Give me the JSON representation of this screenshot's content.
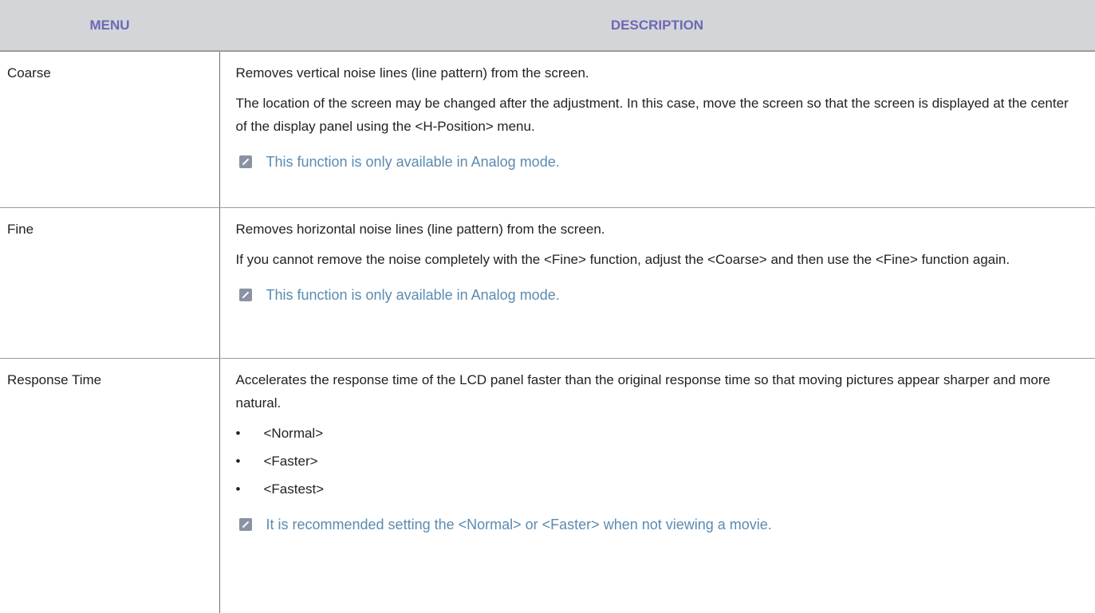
{
  "header": {
    "menu_label": "MENU",
    "description_label": "DESCRIPTION"
  },
  "rows": [
    {
      "menu": "Coarse",
      "paragraphs": [
        "Removes vertical noise lines (line pattern) from the screen.",
        "The location of the screen may be changed after the adjustment. In this case, move the screen so that the screen is displayed at the center of the display panel using the <H-Position> menu."
      ],
      "note": "This function is only available in Analog mode."
    },
    {
      "menu": "Fine",
      "paragraphs": [
        "Removes horizontal noise lines (line pattern) from the screen.",
        "If you cannot remove the noise completely with the <Fine> function, adjust the <Coarse> and then use the <Fine> function again."
      ],
      "note": "This function is only available in Analog mode."
    },
    {
      "menu": "Response Time",
      "paragraphs": [
        "Accelerates the response time of the LCD panel faster than the original response time so that moving pictures appear sharper and more natural."
      ],
      "bullet_char": "•",
      "bullets": [
        "<Normal>",
        "<Faster>",
        "<Fastest>"
      ],
      "note": "It is recommended setting the <Normal> or <Faster> when not viewing a movie."
    }
  ],
  "colors": {
    "header_bg": "#d4d5d9",
    "header_text": "#6b69b5",
    "note_text": "#5b8bb0"
  },
  "icons": {
    "note": "note-pencil-icon"
  }
}
